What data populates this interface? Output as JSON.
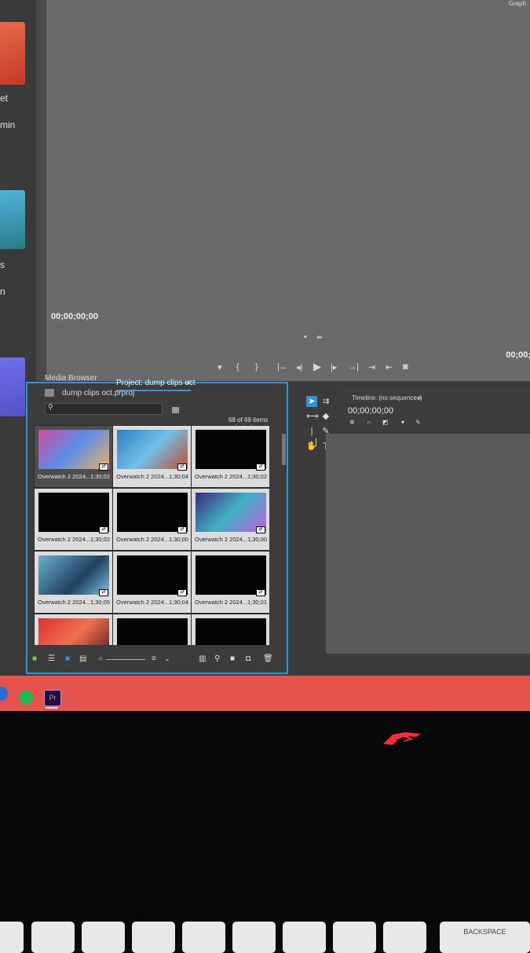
{
  "monitor": {
    "timecode_left": "00;00;00;00",
    "timecode_right": "00;00;",
    "corner_label": "Graph"
  },
  "left_panel": {
    "label1": "et",
    "label2": "min",
    "label3": "s",
    "label4": "n"
  },
  "project_panel": {
    "tab_media_browser": "Media Browser",
    "tab_project": "Project: dump clips oct",
    "file_name": "dump clips oct.prproj",
    "search_placeholder": "",
    "selection_status": "68 of 69 items selected",
    "clips": [
      {
        "name": "Overwatch 2 2024...",
        "duration": "1;30;02",
        "thumb": "pink",
        "selected": false
      },
      {
        "name": "Overwatch 2 2024...",
        "duration": "1;30;04",
        "thumb": "blue",
        "selected": true
      },
      {
        "name": "Overwatch 2 2024...",
        "duration": "1;30;02",
        "thumb": "black",
        "selected": true
      },
      {
        "name": "Overwatch 2 2024...",
        "duration": "1;30;02",
        "thumb": "black",
        "selected": true
      },
      {
        "name": "Overwatch 2 2024...",
        "duration": "1;30;00",
        "thumb": "black",
        "selected": true
      },
      {
        "name": "Overwatch 2 2024...",
        "duration": "1;30;00",
        "thumb": "purple",
        "selected": true
      },
      {
        "name": "Overwatch 2 2024...",
        "duration": "1;30;05",
        "thumb": "teal",
        "selected": true
      },
      {
        "name": "Overwatch 2 2024...",
        "duration": "1;30;04",
        "thumb": "black",
        "selected": true
      },
      {
        "name": "Overwatch 2 2024...",
        "duration": "1;30;01",
        "thumb": "black",
        "selected": true
      },
      {
        "name": "",
        "duration": "",
        "thumb": "red",
        "selected": true
      },
      {
        "name": "",
        "duration": "",
        "thumb": "black",
        "selected": true
      },
      {
        "name": "",
        "duration": "",
        "thumb": "black",
        "selected": true
      }
    ]
  },
  "timeline": {
    "title": "Timeline: (no sequences)",
    "timecode": "00;00;00;00"
  },
  "keyboard": {
    "backspace": "BACKSPACE"
  },
  "colors": {
    "accent": "#2d96d6",
    "taskbar": "#e5534b",
    "premiere": "#9999ff"
  },
  "taskbar_icons": [
    "spotify-icon",
    "premiere-pro-icon"
  ]
}
